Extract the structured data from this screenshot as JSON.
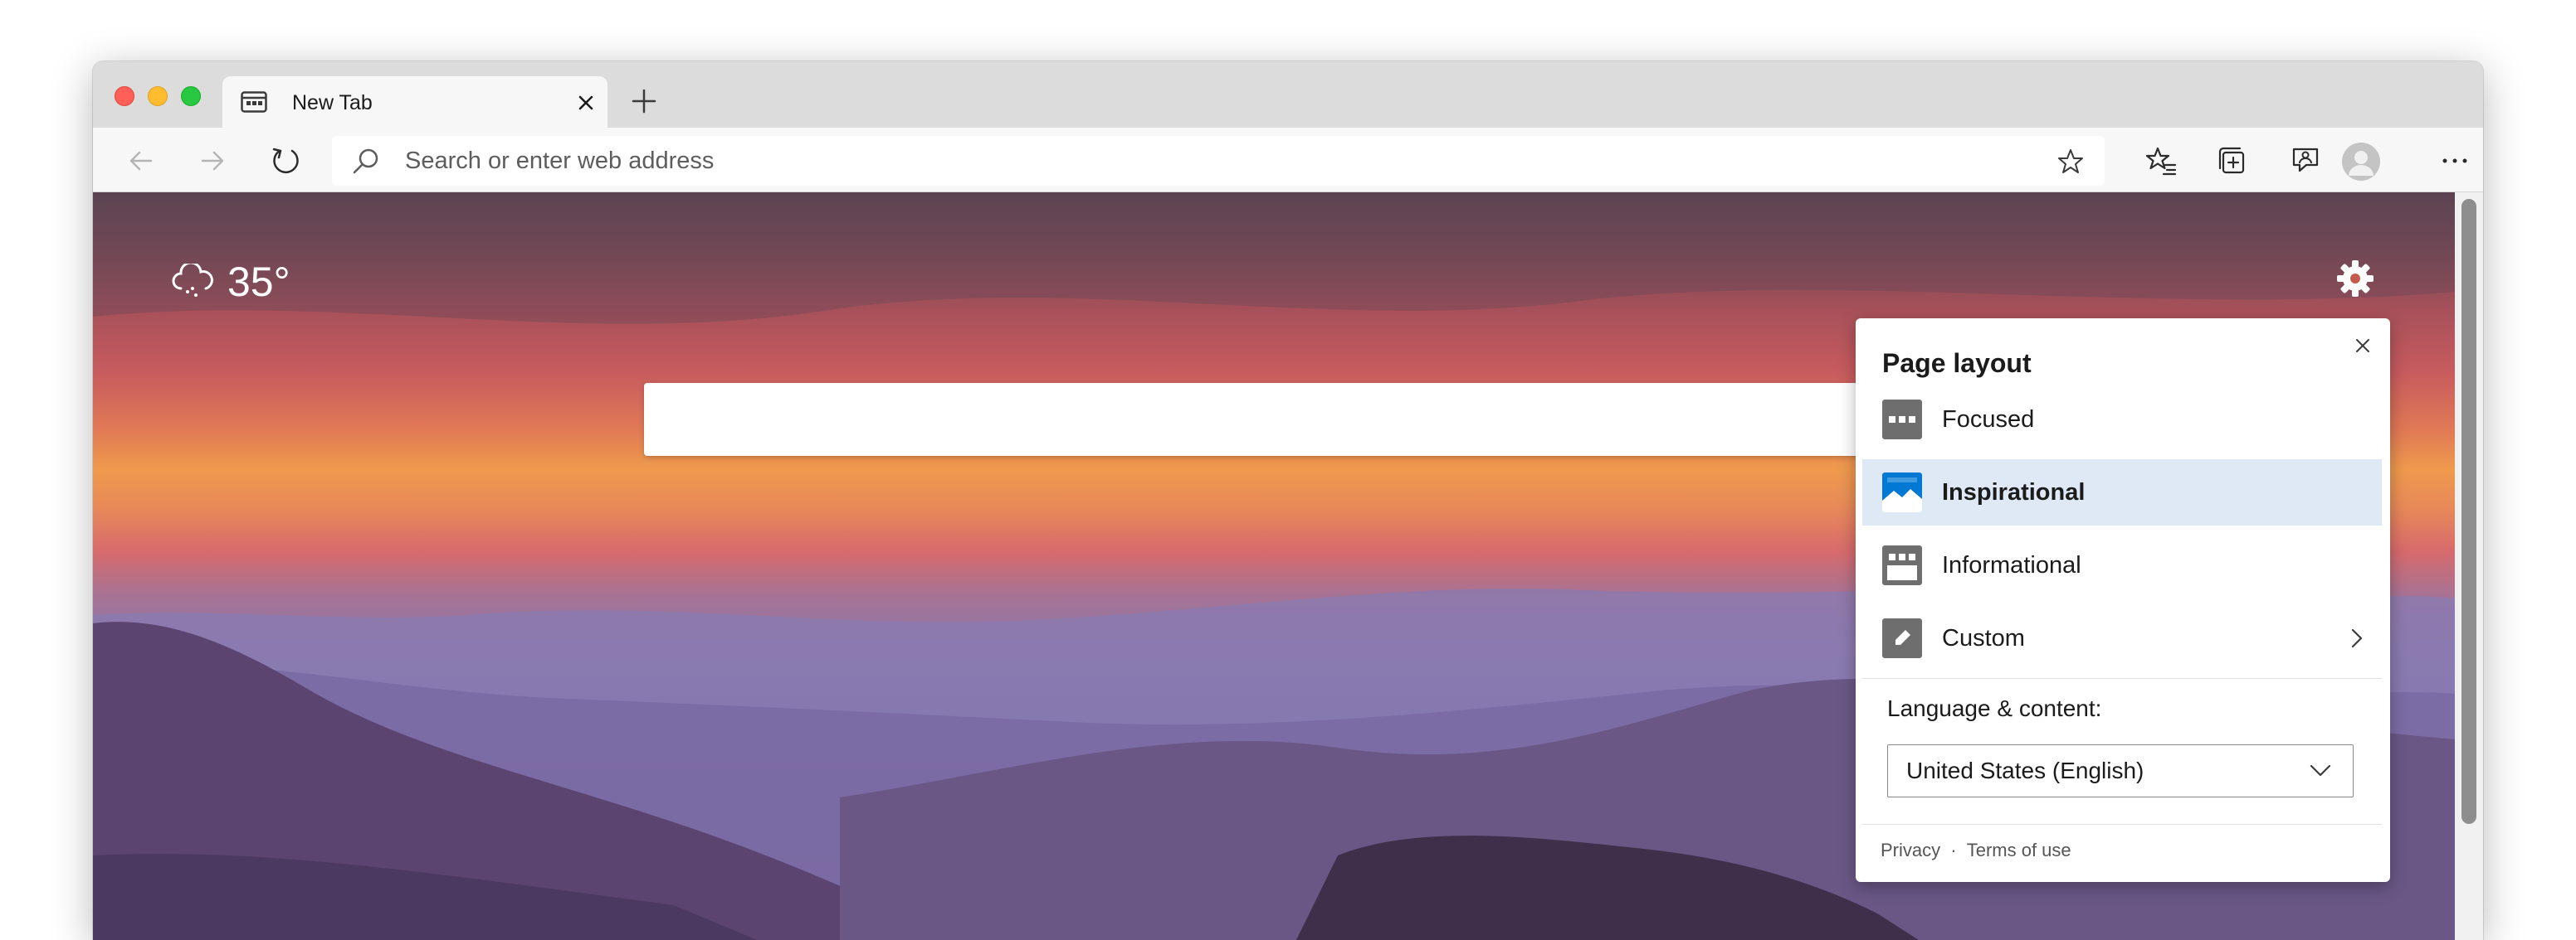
{
  "window": {
    "tab": {
      "title": "New Tab",
      "icon": "new-tab-page-icon"
    },
    "toolbar": {
      "address_placeholder": "Search or enter web address",
      "icons": [
        "back-icon",
        "forward-icon",
        "refresh-icon",
        "search-icon",
        "favorite-star-icon",
        "favorites-icon",
        "collections-icon",
        "feedback-icon",
        "profile-icon",
        "more-icon"
      ]
    }
  },
  "new_tab_page": {
    "weather": {
      "temperature": "35°",
      "icon": "cloud-snow-icon"
    },
    "settings_icon": "gear-icon",
    "background": "sunset-mountains"
  },
  "panel": {
    "title": "Page layout",
    "layouts": [
      {
        "label": "Focused",
        "icon": "focused-layout-icon",
        "selected": false
      },
      {
        "label": "Inspirational",
        "icon": "inspirational-layout-icon",
        "selected": true
      },
      {
        "label": "Informational",
        "icon": "informational-layout-icon",
        "selected": false
      },
      {
        "label": "Custom",
        "icon": "custom-layout-icon",
        "selected": false
      }
    ],
    "language_label": "Language & content:",
    "language_value": "United States (English)",
    "footer": {
      "privacy": "Privacy",
      "separator": "·",
      "terms": "Terms of use"
    }
  },
  "colors": {
    "accent": "#0078d4",
    "selected_bg": "#dfe9f5"
  }
}
